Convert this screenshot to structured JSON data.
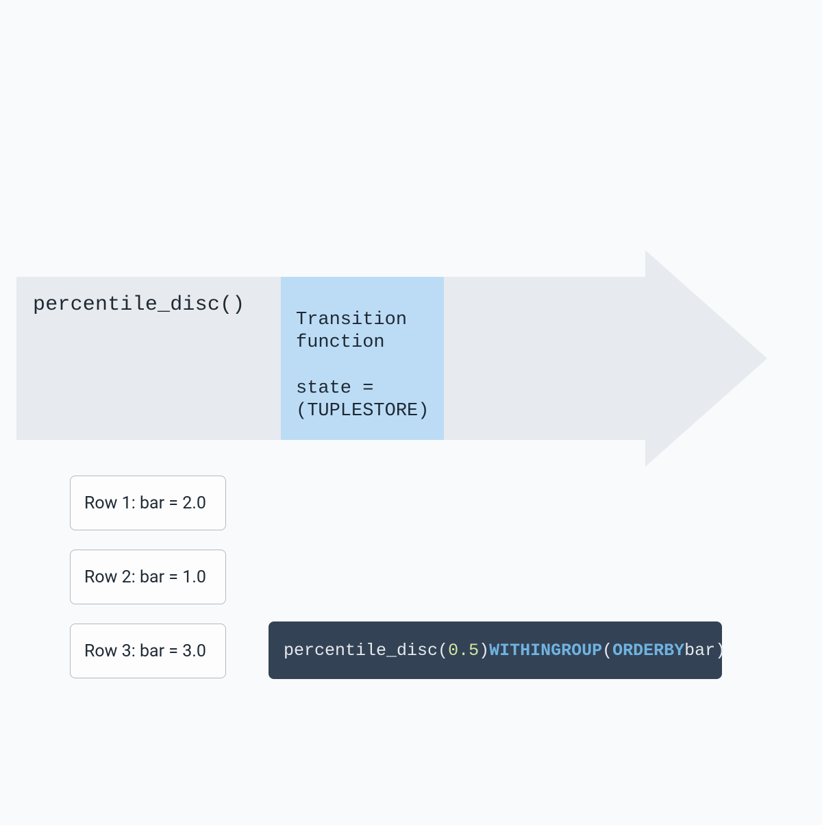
{
  "arrow": {
    "title": "percentile_disc()"
  },
  "transition": {
    "line1": "Transition",
    "line2": "function",
    "state1": "state =",
    "state2": "(TUPLESTORE)"
  },
  "rows": [
    {
      "label": "Row 1: bar = 2.0"
    },
    {
      "label": "Row 2: bar = 1.0"
    },
    {
      "label": "Row 3: bar = 3.0"
    }
  ],
  "code": {
    "fn": "percentile_disc",
    "open": "(",
    "arg": "0.5",
    "close": ")",
    "space": " ",
    "within": "WITHIN",
    "group": "GROUP",
    "open2": "(",
    "order": "ORDER",
    "by": "BY",
    "ident": "bar",
    "close2": ")"
  }
}
